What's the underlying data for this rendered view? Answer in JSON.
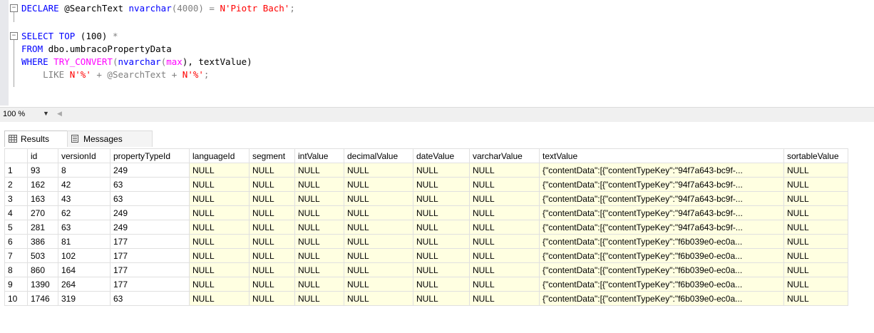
{
  "editor": {
    "line1": {
      "kw1": "DECLARE",
      "var": " @SearchText ",
      "type": "nvarchar",
      "paren": "(4000) = ",
      "str": "N'Piotr Bach'",
      "end": ";"
    },
    "line3": {
      "kw1": "SELECT",
      "mid": " TOP ",
      "val": "(100) ",
      "star": "*"
    },
    "line4": {
      "kw": "FROM",
      "rest": " dbo.umbracoPropertyData"
    },
    "line5": {
      "kw": "WHERE",
      "fn": "TRY_CONVERT",
      "open": "(",
      "type": "nvarchar",
      "open2": "(",
      "max": "max",
      "close2": "), textValue)"
    },
    "line6": {
      "like": "LIKE",
      "s1": "N'%'",
      "plus1": " + @SearchText + ",
      "s2": "N'%'",
      "end": ";"
    }
  },
  "zoom": {
    "label": "100 %"
  },
  "tabs": {
    "results": "Results",
    "messages": "Messages"
  },
  "grid": {
    "columns": [
      "",
      "id",
      "versionId",
      "propertyTypeId",
      "languageId",
      "segment",
      "intValue",
      "decimalValue",
      "dateValue",
      "varcharValue",
      "textValue",
      "sortableValue"
    ],
    "rows": [
      [
        "1",
        "93",
        "8",
        "249",
        "NULL",
        "NULL",
        "NULL",
        "NULL",
        "NULL",
        "NULL",
        "{\"contentData\":[{\"contentTypeKey\":\"94f7a643-bc9f-...",
        "NULL"
      ],
      [
        "2",
        "162",
        "42",
        "63",
        "NULL",
        "NULL",
        "NULL",
        "NULL",
        "NULL",
        "NULL",
        "{\"contentData\":[{\"contentTypeKey\":\"94f7a643-bc9f-...",
        "NULL"
      ],
      [
        "3",
        "163",
        "43",
        "63",
        "NULL",
        "NULL",
        "NULL",
        "NULL",
        "NULL",
        "NULL",
        "{\"contentData\":[{\"contentTypeKey\":\"94f7a643-bc9f-...",
        "NULL"
      ],
      [
        "4",
        "270",
        "62",
        "249",
        "NULL",
        "NULL",
        "NULL",
        "NULL",
        "NULL",
        "NULL",
        "{\"contentData\":[{\"contentTypeKey\":\"94f7a643-bc9f-...",
        "NULL"
      ],
      [
        "5",
        "281",
        "63",
        "249",
        "NULL",
        "NULL",
        "NULL",
        "NULL",
        "NULL",
        "NULL",
        "{\"contentData\":[{\"contentTypeKey\":\"94f7a643-bc9f-...",
        "NULL"
      ],
      [
        "6",
        "386",
        "81",
        "177",
        "NULL",
        "NULL",
        "NULL",
        "NULL",
        "NULL",
        "NULL",
        "{\"contentData\":[{\"contentTypeKey\":\"f6b039e0-ec0a...",
        "NULL"
      ],
      [
        "7",
        "503",
        "102",
        "177",
        "NULL",
        "NULL",
        "NULL",
        "NULL",
        "NULL",
        "NULL",
        "{\"contentData\":[{\"contentTypeKey\":\"f6b039e0-ec0a...",
        "NULL"
      ],
      [
        "8",
        "860",
        "164",
        "177",
        "NULL",
        "NULL",
        "NULL",
        "NULL",
        "NULL",
        "NULL",
        "{\"contentData\":[{\"contentTypeKey\":\"f6b039e0-ec0a...",
        "NULL"
      ],
      [
        "9",
        "1390",
        "264",
        "177",
        "NULL",
        "NULL",
        "NULL",
        "NULL",
        "NULL",
        "NULL",
        "{\"contentData\":[{\"contentTypeKey\":\"f6b039e0-ec0a...",
        "NULL"
      ],
      [
        "10",
        "1746",
        "319",
        "63",
        "NULL",
        "NULL",
        "NULL",
        "NULL",
        "NULL",
        "NULL",
        "{\"contentData\":[{\"contentTypeKey\":\"f6b039e0-ec0a...",
        "NULL"
      ]
    ]
  }
}
